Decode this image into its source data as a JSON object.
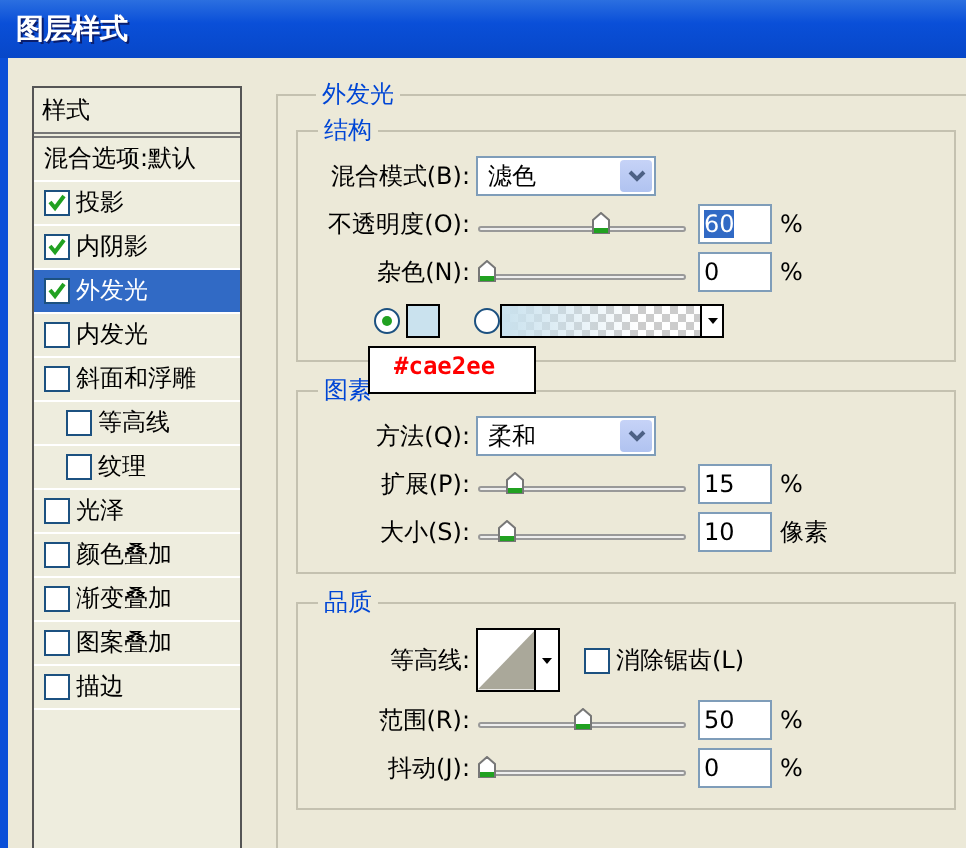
{
  "window": {
    "title": "图层样式"
  },
  "sidebar": {
    "header": "样式",
    "blend_options": "混合选项:默认",
    "items": [
      {
        "label": "投影",
        "checked": true,
        "selected": false
      },
      {
        "label": "内阴影",
        "checked": true,
        "selected": false
      },
      {
        "label": "外发光",
        "checked": true,
        "selected": true
      },
      {
        "label": "内发光",
        "checked": false,
        "selected": false
      },
      {
        "label": "斜面和浮雕",
        "checked": false,
        "selected": false,
        "children": [
          {
            "label": "等高线",
            "checked": false,
            "selected": false
          },
          {
            "label": "纹理",
            "checked": false,
            "selected": false
          }
        ]
      },
      {
        "label": "光泽",
        "checked": false,
        "selected": false
      },
      {
        "label": "颜色叠加",
        "checked": false,
        "selected": false
      },
      {
        "label": "渐变叠加",
        "checked": false,
        "selected": false
      },
      {
        "label": "图案叠加",
        "checked": false,
        "selected": false
      },
      {
        "label": "描边",
        "checked": false,
        "selected": false
      }
    ]
  },
  "panel": {
    "title": "外发光",
    "groups": [
      {
        "title": "结构",
        "rows": [
          {
            "kind": "dropdown",
            "label": "混合模式(B):",
            "value": "滤色"
          },
          {
            "kind": "slider",
            "label": "不透明度(O):",
            "level": 0.6,
            "value": "60",
            "value_selected": true,
            "unit": "%"
          },
          {
            "kind": "slider",
            "label": "杂色(N):",
            "level": 0,
            "value": "0",
            "value_selected": false,
            "unit": "%"
          },
          {
            "kind": "fill",
            "options": [
              {
                "kind": "solid",
                "selected": true,
                "color": "#cae2ee"
              },
              {
                "kind": "gradient",
                "selected": false,
                "color": "#cae2ee"
              }
            ]
          }
        ]
      },
      {
        "title": "图素",
        "rows": [
          {
            "kind": "dropdown",
            "label": "方法(Q):",
            "value": "柔和"
          },
          {
            "kind": "slider",
            "label": "扩展(P):",
            "level": 0.15,
            "value": "15",
            "value_selected": false,
            "unit": "%"
          },
          {
            "kind": "slider",
            "label": "大小(S):",
            "level": 0.1,
            "value": "10",
            "value_selected": false,
            "unit": "像素"
          }
        ]
      },
      {
        "title": "品质",
        "rows": [
          {
            "kind": "contour",
            "label": "等高线:",
            "checkbox": {
              "label": "消除锯齿(L)",
              "checked": false
            }
          },
          {
            "kind": "slider",
            "label": "范围(R):",
            "level": 0.5,
            "value": "50",
            "value_selected": false,
            "unit": "%"
          },
          {
            "kind": "slider",
            "label": "抖动(J):",
            "level": 0,
            "value": "0",
            "value_selected": false,
            "unit": "%"
          }
        ]
      }
    ]
  },
  "annotation": {
    "text": "#cae2ee"
  }
}
